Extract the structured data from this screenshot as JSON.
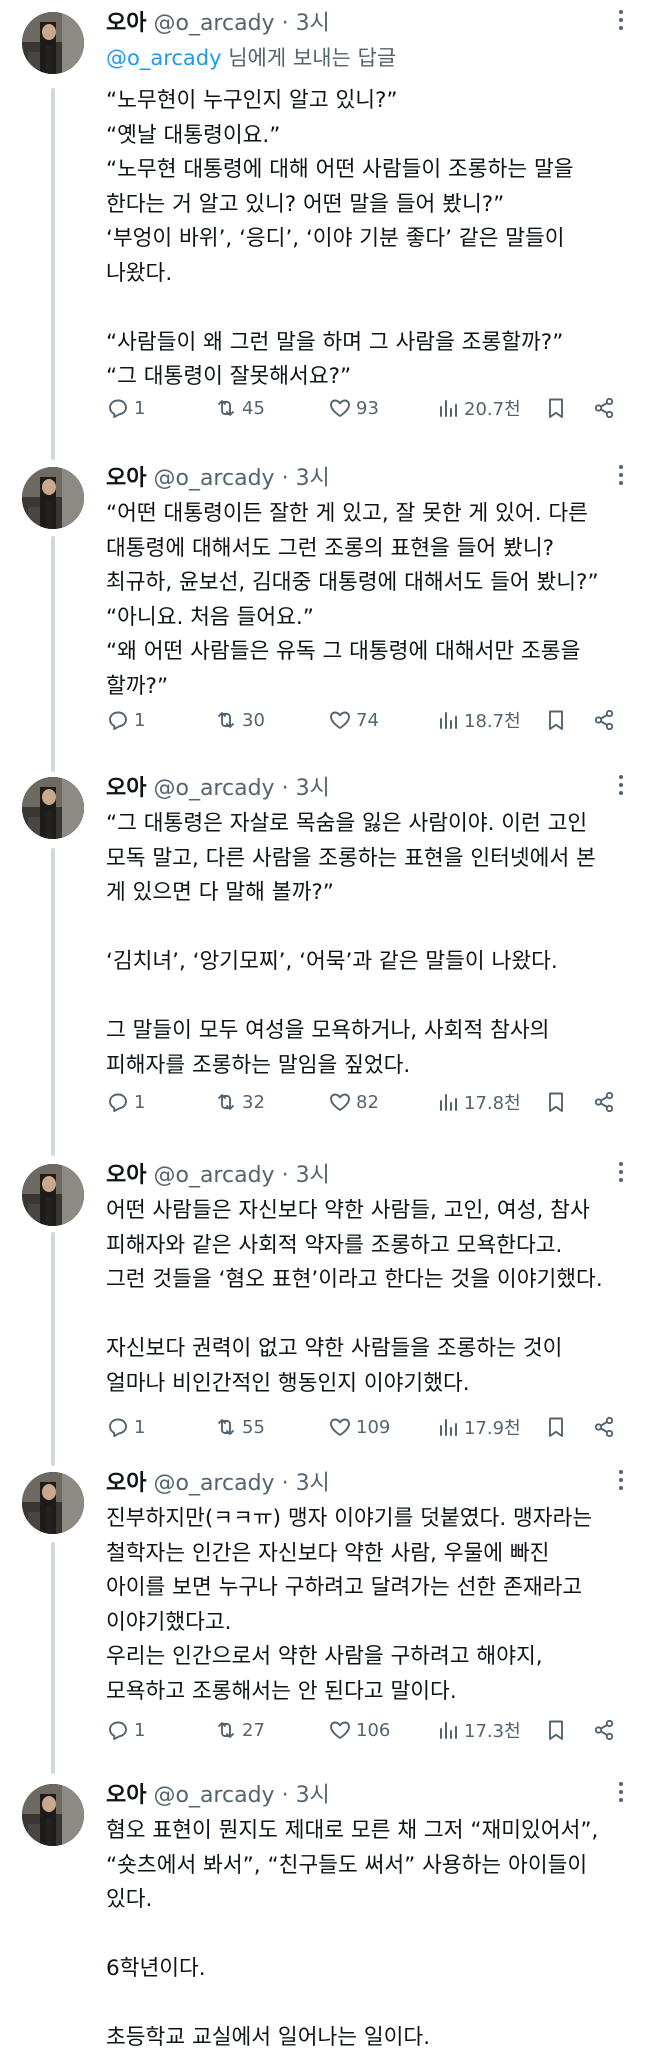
{
  "tweets": [
    {
      "name": "오아",
      "handle": "@o_arcady",
      "dot": "·",
      "time": "3시",
      "reply_to": {
        "mention": "@o_arcady",
        "suffix": " 님에게 보내는 답글"
      },
      "lines": [
        "“노무현이 누구인지 알고 있니?”",
        "“옛날 대통령이요.”",
        "“노무현 대통령에 대해 어떤 사람들이 조롱하는 말을",
        "한다는 거 알고 있니? 어떤 말을 들어 봤니?”",
        "‘부엉이 바위’, ‘응디’, ‘이야 기분 좋다’ 같은 말들이",
        "나왔다.",
        "",
        "“사람들이 왜 그런 말을 하며 그 사람을 조롱할까?”",
        "“그 대통령이 잘못해서요?”"
      ],
      "stats": {
        "replies": "1",
        "retweets": "45",
        "likes": "93",
        "views": "20.7천"
      }
    },
    {
      "name": "오아",
      "handle": "@o_arcady",
      "dot": "·",
      "time": "3시",
      "lines": [
        "“어떤 대통령이든 잘한 게 있고, 잘 못한 게 있어. 다른",
        "대통령에 대해서도 그런 조롱의 표현을 들어 봤니?",
        "최규하, 윤보선, 김대중 대통령에 대해서도 들어 봤니?”",
        "“아니요. 처음 들어요.”",
        "“왜 어떤 사람들은 유독 그 대통령에 대해서만 조롱을",
        "할까?”"
      ],
      "stats": {
        "replies": "1",
        "retweets": "30",
        "likes": "74",
        "views": "18.7천"
      }
    },
    {
      "name": "오아",
      "handle": "@o_arcady",
      "dot": "·",
      "time": "3시",
      "lines": [
        "“그 대통령은 자살로 목숨을 잃은 사람이야. 이런 고인",
        "모독 말고, 다른 사람을 조롱하는 표현을 인터넷에서 본",
        "게 있으면 다 말해 볼까?”",
        "",
        "‘김치녀’, ‘앙기모찌’, ‘어묵’과 같은 말들이 나왔다.",
        "",
        "그 말들이 모두 여성을 모욕하거나, 사회적 참사의",
        "피해자를 조롱하는 말임을 짚었다."
      ],
      "stats": {
        "replies": "1",
        "retweets": "32",
        "likes": "82",
        "views": "17.8천"
      }
    },
    {
      "name": "오아",
      "handle": "@o_arcady",
      "dot": "·",
      "time": "3시",
      "lines": [
        "어떤 사람들은 자신보다 약한 사람들, 고인, 여성, 참사",
        "피해자와 같은 사회적 약자를 조롱하고 모욕한다고.",
        "그런 것들을 ‘혐오 표현’이라고 한다는 것을 이야기했다.",
        "",
        "자신보다 권력이 없고 약한 사람들을 조롱하는 것이",
        "얼마나 비인간적인 행동인지 이야기했다."
      ],
      "stats": {
        "replies": "1",
        "retweets": "55",
        "likes": "109",
        "views": "17.9천"
      }
    },
    {
      "name": "오아",
      "handle": "@o_arcady",
      "dot": "·",
      "time": "3시",
      "lines": [
        "진부하지만(ㅋㅋㅠ) 맹자 이야기를 덧붙였다. 맹자라는",
        "철학자는 인간은 자신보다 약한 사람, 우물에 빠진",
        "아이를 보면 누구나 구하려고 달려가는 선한 존재라고",
        "이야기했다고.",
        "우리는 인간으로서 약한 사람을 구하려고 해야지,",
        "모욕하고 조롱해서는 안 된다고 말이다."
      ],
      "stats": {
        "replies": "1",
        "retweets": "27",
        "likes": "106",
        "views": "17.3천"
      }
    },
    {
      "name": "오아",
      "handle": "@o_arcady",
      "dot": "·",
      "time": "3시",
      "lines": [
        "혐오 표현이 뭔지도 제대로 모른 채 그저 “재미있어서”,",
        "“숏츠에서 봐서”, “친구들도 써서” 사용하는 아이들이",
        "있다.",
        "",
        "6학년이다.",
        "",
        "초등학교 교실에서 일어나는 일이다."
      ]
    }
  ]
}
